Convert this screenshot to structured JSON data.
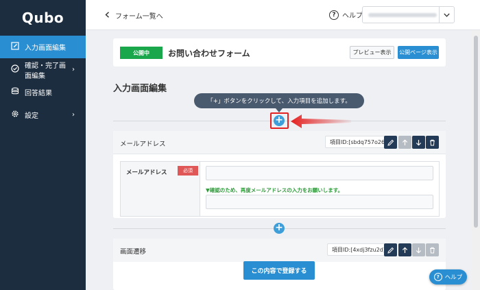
{
  "brand": {
    "logo": "Qubo"
  },
  "sidebar": {
    "items": [
      {
        "label": "入力画面編集",
        "icon": "edit-icon",
        "active": true
      },
      {
        "label": "確認・完了画面編集",
        "icon": "check-circle-icon",
        "has_chevron": true
      },
      {
        "label": "回答結果",
        "icon": "database-icon"
      },
      {
        "label": "設定",
        "icon": "gear-icon",
        "has_chevron": true
      }
    ],
    "chevron": "›"
  },
  "topbar": {
    "back_label": "フォーム一覧へ",
    "help_label": "ヘルプ"
  },
  "status": {
    "badge": "公開中",
    "form_title": "お問い合わせフォーム",
    "preview_button": "プレビュー表示",
    "public_page_button": "公開ページ表示",
    "badge_color": "#1aa64b"
  },
  "main": {
    "heading": "入力画面編集",
    "tooltip": "「+」ボタンをクリックして、入力項目を追加します。",
    "add_symbol": "+"
  },
  "fields": [
    {
      "title": "メールアドレス",
      "item_id": "項目ID:[sbdq757o26]",
      "label": "メールアドレス",
      "required_badge": "必須",
      "confirm_note": "▼確認のため、再度メールアドレスの入力をお願いします。"
    },
    {
      "title": "画面遷移",
      "item_id": "項目ID:[4xdj3fzu2d]",
      "submit_button": "この内容で登録する"
    }
  ],
  "help_fab": {
    "label": "ヘルプ"
  },
  "colors": {
    "accent": "#2a8fd2",
    "sidebar": "#1c2d3f",
    "highlight": "#e52020"
  }
}
